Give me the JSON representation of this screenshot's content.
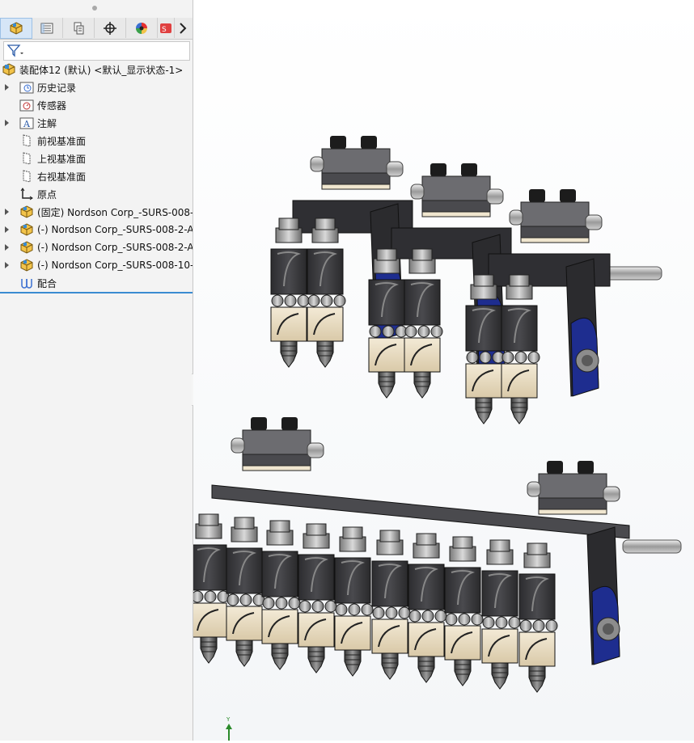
{
  "tabs": [
    {
      "name": "feature-manager-tab",
      "icon": "assembly-cube-icon"
    },
    {
      "name": "property-manager-tab",
      "icon": "property-list-icon"
    },
    {
      "name": "configuration-manager-tab",
      "icon": "configuration-icon"
    },
    {
      "name": "dimxpert-tab",
      "icon": "crosshair-icon"
    },
    {
      "name": "display-manager-tab",
      "icon": "color-wheel-icon"
    },
    {
      "name": "more-tabs",
      "icon": "chevron-right-icon"
    }
  ],
  "tree": {
    "root": "装配体12 (默认) <默认_显示状态-1>",
    "items": [
      {
        "label": "历史记录",
        "icon": "history-folder-icon",
        "expandable": true
      },
      {
        "label": "传感器",
        "icon": "sensor-folder-icon",
        "expandable": false
      },
      {
        "label": "注解",
        "icon": "annotation-folder-icon",
        "expandable": true
      },
      {
        "label": "前视基准面",
        "icon": "plane-icon",
        "expandable": false
      },
      {
        "label": "上视基准面",
        "icon": "plane-icon",
        "expandable": false
      },
      {
        "label": "右视基准面",
        "icon": "plane-icon",
        "expandable": false
      },
      {
        "label": "原点",
        "icon": "origin-icon",
        "expandable": false
      },
      {
        "label": "(固定) Nordson Corp_-SURS-008-",
        "icon": "subassembly-icon",
        "expandable": true
      },
      {
        "label": "(-) Nordson Corp_-SURS-008-2-A",
        "icon": "subassembly-icon",
        "expandable": true
      },
      {
        "label": "(-) Nordson Corp_-SURS-008-2-A",
        "icon": "subassembly-icon",
        "expandable": true
      },
      {
        "label": "(-) Nordson Corp_-SURS-008-10-",
        "icon": "subassembly-icon",
        "expandable": true
      },
      {
        "label": "配合",
        "icon": "mates-icon",
        "expandable": false
      }
    ]
  },
  "triad": {
    "axis_label": "Y"
  },
  "colors": {
    "accent": "#3a8bd1",
    "panel": "#f3f3f3",
    "part_dark": "#3d3d40",
    "part_blue": "#1e2d8f",
    "part_tan": "#ece0c8"
  }
}
